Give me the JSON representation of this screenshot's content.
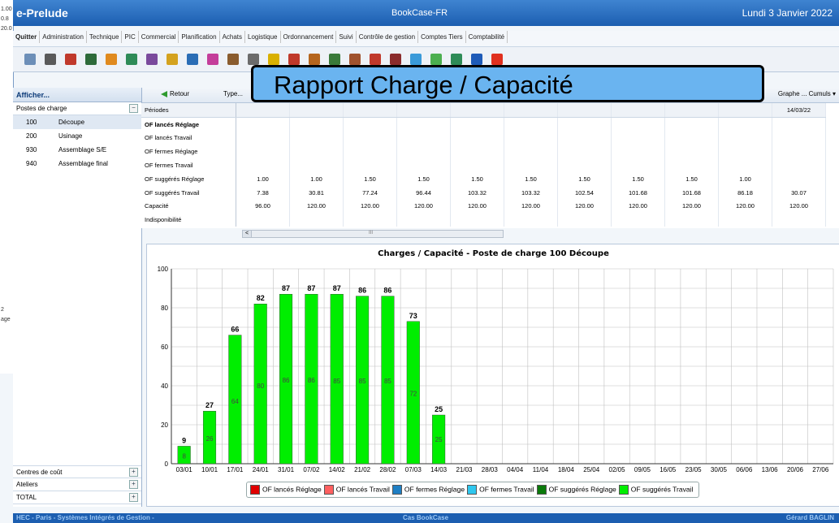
{
  "app": {
    "name": "e-Prelude",
    "database": "BookCase-FR",
    "date": "Lundi 3 Janvier 2022"
  },
  "background_window": {
    "values": [
      "1.00",
      "0.8",
      "20.0",
      "2",
      "age"
    ]
  },
  "menu": [
    "Quitter",
    "Administration",
    "Technique",
    "PIC",
    "Commercial",
    "Planification",
    "Achats",
    "Logistique",
    "Ordonnancement",
    "Suivi",
    "Contrôle de gestion",
    "Comptes Tiers",
    "Comptabilité"
  ],
  "toolbar_icons": [
    {
      "name": "save-icon",
      "color": "#6d8fb8"
    },
    {
      "name": "print-icon",
      "color": "#5a5a5a"
    },
    {
      "name": "tool-red-icon",
      "color": "#c0392b"
    },
    {
      "name": "tool-book-icon",
      "color": "#2e6b3a"
    },
    {
      "name": "tool-orange-icon",
      "color": "#e08a1e"
    },
    {
      "name": "tool-tree-icon",
      "color": "#2e8b57"
    },
    {
      "name": "tool-grid-icon",
      "color": "#7a4a9c"
    },
    {
      "name": "tool-flower-icon",
      "color": "#d4a21e"
    },
    {
      "name": "tool-table-icon",
      "color": "#2a6db5"
    },
    {
      "name": "bar-chart-icon",
      "color": "#c43d9a"
    },
    {
      "name": "tool-gear-icon",
      "color": "#8a5c2e"
    },
    {
      "name": "tool-wheel-icon",
      "color": "#6b6b6b"
    },
    {
      "name": "tool-edit-icon",
      "color": "#d9b000"
    },
    {
      "name": "tool-person-icon",
      "color": "#c0392b"
    },
    {
      "name": "tool-disc-icon",
      "color": "#b5651d"
    },
    {
      "name": "tool-report-icon",
      "color": "#3a7a3a"
    },
    {
      "name": "tool-coin-icon",
      "color": "#a0522d"
    },
    {
      "name": "tool-music-icon",
      "color": "#c0392b"
    },
    {
      "name": "tool-dot-icon",
      "color": "#8b2c2c"
    },
    {
      "name": "tool-diamond-icon",
      "color": "#3a9ad9"
    },
    {
      "name": "tool-people-icon",
      "color": "#4caf50"
    },
    {
      "name": "tool-export-icon",
      "color": "#2e8b57"
    },
    {
      "name": "help-icon",
      "color": "#1e5bb8"
    },
    {
      "name": "up-arrow-icon",
      "color": "#e0301e"
    }
  ],
  "overlay_title": "Rapport Charge / Capacité",
  "sidebar": {
    "header": "Afficher...",
    "section": "Postes de charge",
    "items": [
      {
        "code": "100",
        "name": "Découpe"
      },
      {
        "code": "200",
        "name": "Usinage"
      },
      {
        "code": "930",
        "name": "Assemblage S/E"
      },
      {
        "code": "940",
        "name": "Assemblage final"
      }
    ],
    "bottom_sections": [
      "Centres de coût",
      "Ateliers",
      "TOTAL"
    ],
    "toggle_minus": "−",
    "toggle_plus": "+"
  },
  "content_toolbar": {
    "back": "Retour",
    "type": "Type...",
    "graph": "Graphe ... Cumuls ▾"
  },
  "table": {
    "header_label": "Périodes",
    "header_last": "14/03/22",
    "rows": [
      {
        "label": "OF lancés Réglage",
        "bold": true,
        "values": [
          "",
          "",
          "",
          "",
          "",
          "",
          "",
          "",
          "",
          "",
          ""
        ]
      },
      {
        "label": "OF lancés Travail",
        "values": [
          "",
          "",
          "",
          "",
          "",
          "",
          "",
          "",
          "",
          "",
          ""
        ]
      },
      {
        "label": "OF fermes Réglage",
        "values": [
          "",
          "",
          "",
          "",
          "",
          "",
          "",
          "",
          "",
          "",
          ""
        ]
      },
      {
        "label": "OF fermes Travail",
        "values": [
          "",
          "",
          "",
          "",
          "",
          "",
          "",
          "",
          "",
          "",
          ""
        ]
      },
      {
        "label": "OF suggérés Réglage",
        "values": [
          "1.00",
          "1.00",
          "1.50",
          "1.50",
          "1.50",
          "1.50",
          "1.50",
          "1.50",
          "1.50",
          "1.00",
          ""
        ]
      },
      {
        "label": "OF suggérés Travail",
        "values": [
          "7.38",
          "30.81",
          "77.24",
          "96.44",
          "103.32",
          "103.32",
          "102.54",
          "101.68",
          "101.68",
          "86.18",
          "30.07"
        ]
      },
      {
        "label": "Capacité",
        "values": [
          "96.00",
          "120.00",
          "120.00",
          "120.00",
          "120.00",
          "120.00",
          "120.00",
          "120.00",
          "120.00",
          "120.00",
          "120.00"
        ]
      },
      {
        "label": "Indisponibilité",
        "values": [
          "",
          "",
          "",
          "",
          "",
          "",
          "",
          "",
          "",
          "",
          ""
        ]
      }
    ]
  },
  "scroll_left": "<",
  "scroll_thumb": "III",
  "chart_data": {
    "type": "bar",
    "title": "Charges / Capacité - Poste de charge 100 Découpe",
    "categories": [
      "03/01",
      "10/01",
      "17/01",
      "24/01",
      "31/01",
      "07/02",
      "14/02",
      "21/02",
      "28/02",
      "07/03",
      "14/03",
      "21/03",
      "28/03",
      "04/04",
      "11/04",
      "18/04",
      "25/04",
      "02/05",
      "09/05",
      "16/05",
      "23/05",
      "30/05",
      "06/06",
      "13/06",
      "20/06",
      "27/06"
    ],
    "ylim": [
      0,
      100
    ],
    "yticks": [
      0,
      20,
      40,
      60,
      80,
      100
    ],
    "totals": [
      9,
      27,
      66,
      82,
      87,
      87,
      87,
      86,
      86,
      73,
      25,
      null,
      null,
      null,
      null,
      null,
      null,
      null,
      null,
      null,
      null,
      null,
      null,
      null,
      null,
      null
    ],
    "inner_labels": [
      8,
      26,
      64,
      80,
      86,
      86,
      85,
      85,
      85,
      72,
      25,
      null,
      null,
      null,
      null,
      null,
      null,
      null,
      null,
      null,
      null,
      null,
      null,
      null,
      null,
      null
    ],
    "colors": {
      "bar": "#00ee00",
      "grid": "#c0c0c0"
    },
    "legend": [
      {
        "label": "OF lancés Réglage",
        "color": "#e00000"
      },
      {
        "label": "OF lancés Travail",
        "color": "#ff6060"
      },
      {
        "label": "OF fermes Réglage",
        "color": "#1e7fc4"
      },
      {
        "label": "OF fermes Travail",
        "color": "#2ec7ee"
      },
      {
        "label": "OF suggérés Réglage",
        "color": "#0a7a0a"
      },
      {
        "label": "OF suggérés Travail",
        "color": "#00ee00"
      }
    ]
  },
  "footer": {
    "left": "HEC - Paris - Systèmes Intégrés de Gestion -",
    "center": "Cas BookCase",
    "right": "Gérard BAGLIN"
  }
}
